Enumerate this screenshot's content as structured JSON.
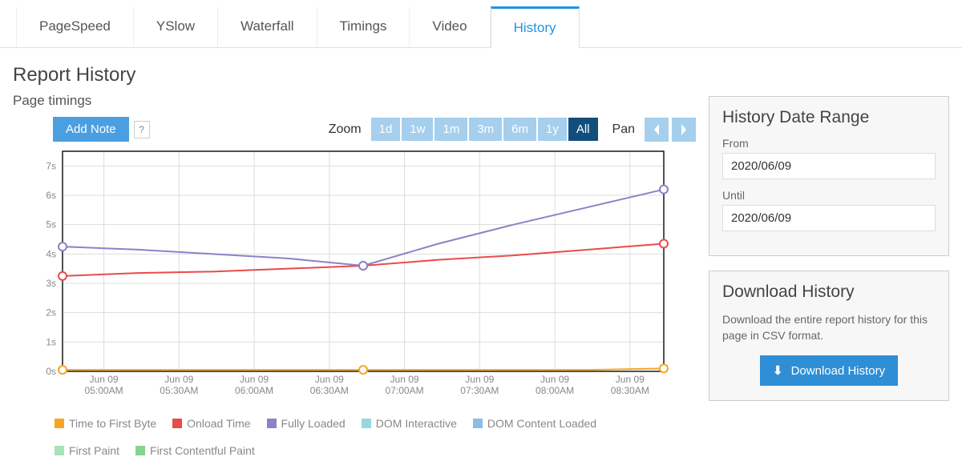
{
  "tabs": [
    "PageSpeed",
    "YSlow",
    "Waterfall",
    "Timings",
    "Video",
    "History"
  ],
  "active_tab": "History",
  "report_title": "Report History",
  "subheading": "Page timings",
  "toolbar": {
    "add_note": "Add Note",
    "help": "?",
    "zoom_label": "Zoom",
    "zoom_options": [
      "1d",
      "1w",
      "1m",
      "3m",
      "6m",
      "1y",
      "All"
    ],
    "zoom_active": "All",
    "pan_label": "Pan"
  },
  "legend": [
    {
      "label": "Time to First Byte",
      "color": "#f5a623"
    },
    {
      "label": "Onload Time",
      "color": "#e94b4b"
    },
    {
      "label": "Fully Loaded",
      "color": "#8c82c8"
    },
    {
      "label": "DOM Interactive",
      "color": "#9ad6e0"
    },
    {
      "label": "DOM Content Loaded",
      "color": "#8abde8"
    },
    {
      "label": "First Paint",
      "color": "#a8e2b8"
    },
    {
      "label": "First Contentful Paint",
      "color": "#86d48f"
    }
  ],
  "sidebar": {
    "range_title": "History Date Range",
    "from_label": "From",
    "from_value": "2020/06/09",
    "until_label": "Until",
    "until_value": "2020/06/09",
    "download_title": "Download History",
    "download_desc": "Download the entire report history for this page in CSV format.",
    "download_button": "Download History"
  },
  "chart_data": {
    "type": "line",
    "title": "",
    "xlabel": "",
    "ylabel": "",
    "ylim": [
      0,
      7.5
    ],
    "ytick_labels": [
      "0s",
      "1s",
      "2s",
      "3s",
      "4s",
      "5s",
      "6s",
      "7s"
    ],
    "x_ticks": [
      "Jun 09\n05:00AM",
      "Jun 09\n05:30AM",
      "Jun 09\n06:00AM",
      "Jun 09\n06:30AM",
      "Jun 09\n07:00AM",
      "Jun 09\n07:30AM",
      "Jun 09\n08:00AM",
      "Jun 09\n08:30AM"
    ],
    "x_points": [
      0,
      1,
      2,
      3,
      4,
      5,
      6,
      7,
      8
    ],
    "markers_at": [
      0,
      4,
      8
    ],
    "series": [
      {
        "name": "Time to First Byte",
        "color": "#f5a623",
        "values": [
          0.05,
          0.05,
          0.05,
          0.05,
          0.05,
          0.05,
          0.05,
          0.05,
          0.1
        ]
      },
      {
        "name": "Onload Time",
        "color": "#e94b4b",
        "values": [
          3.25,
          3.35,
          3.4,
          3.5,
          3.6,
          3.8,
          3.95,
          4.15,
          4.35
        ]
      },
      {
        "name": "Fully Loaded",
        "color": "#8c82c8",
        "values": [
          4.25,
          4.15,
          4.0,
          3.85,
          3.6,
          4.35,
          5.0,
          5.6,
          6.2
        ]
      }
    ]
  }
}
